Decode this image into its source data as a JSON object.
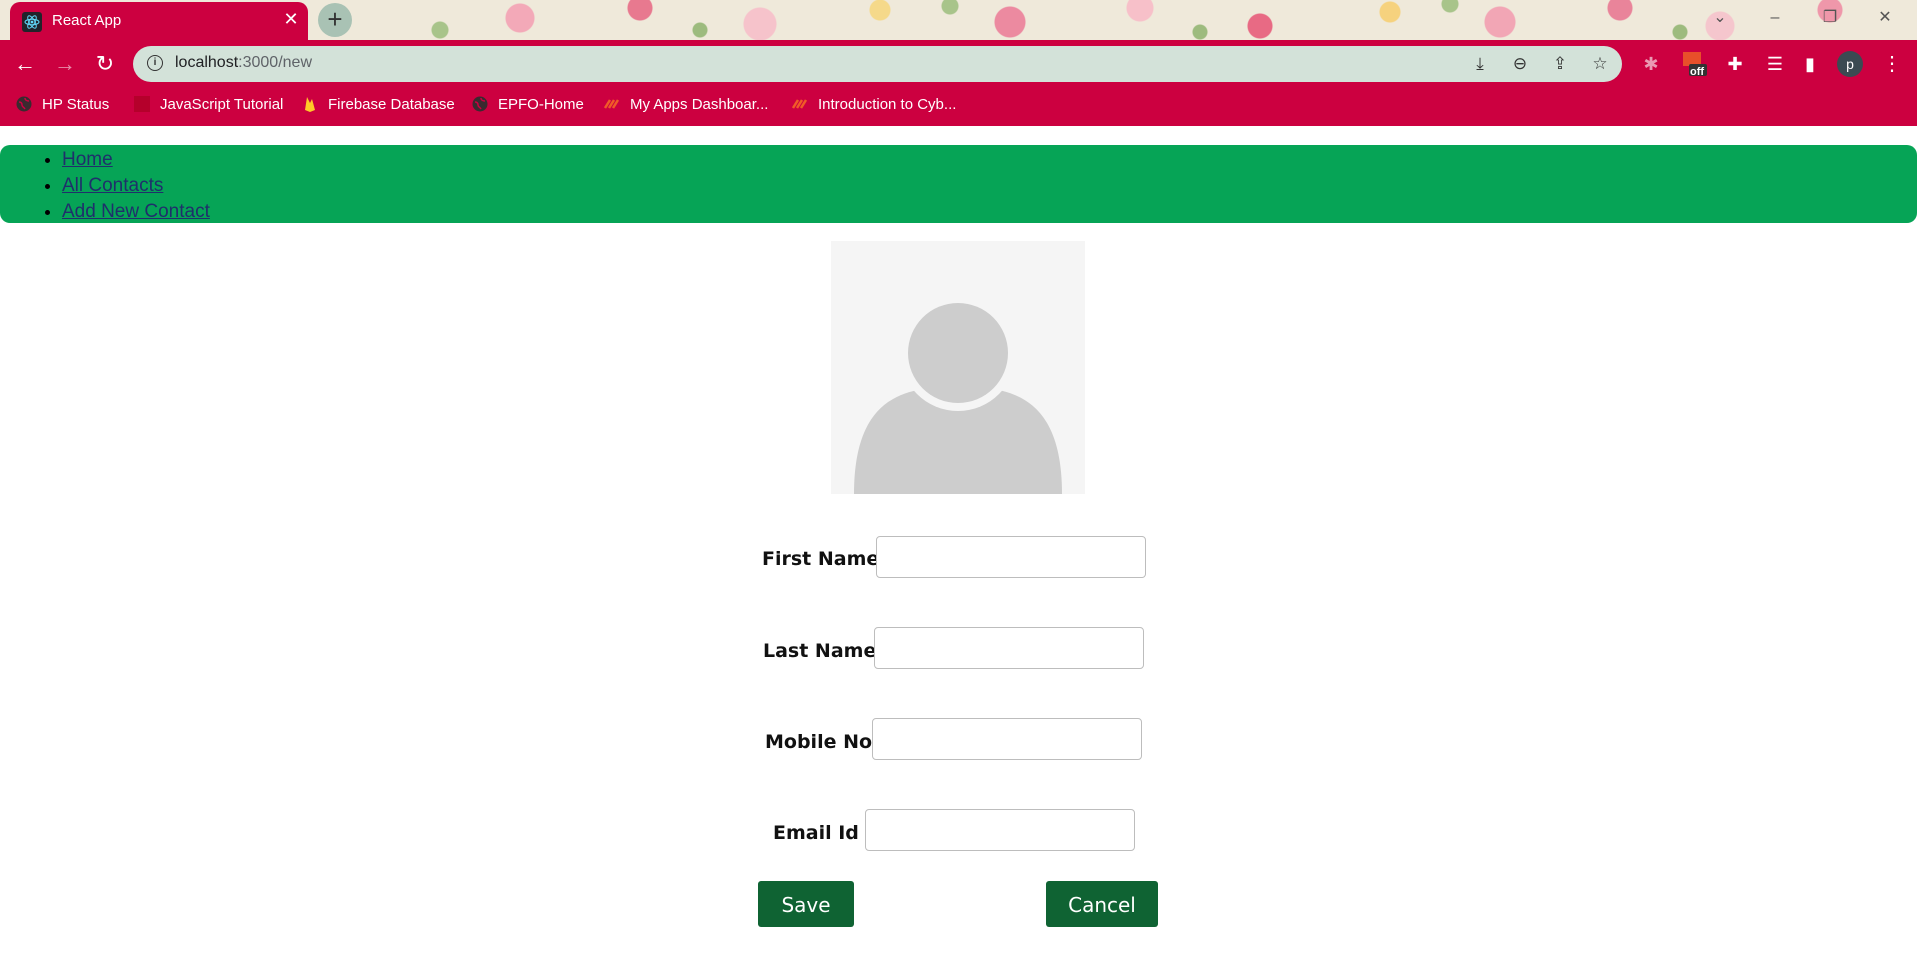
{
  "browser": {
    "tab_title": "React App",
    "url_host": "localhost",
    "url_path": ":3000/new",
    "accent_color": "#cc0040",
    "bookmarks": [
      {
        "label": "HP Status",
        "icon": "globe-icon"
      },
      {
        "label": "JavaScript Tutorial",
        "icon": "js-icon"
      },
      {
        "label": "Firebase Database",
        "icon": "firebase-icon"
      },
      {
        "label": "EPFO-Home",
        "icon": "globe-icon"
      },
      {
        "label": "My Apps Dashboar...",
        "icon": "apps-icon"
      },
      {
        "label": "Introduction to Cyb...",
        "icon": "apps-icon"
      }
    ],
    "profile_initial": "p",
    "pdf_badge": "off"
  },
  "nav": {
    "color": "#06a456",
    "links": [
      {
        "label": "Home"
      },
      {
        "label": "All Contacts"
      },
      {
        "label": "Add New Contact"
      }
    ]
  },
  "form": {
    "first_name_label": "First Name :",
    "last_name_label": "Last Name :",
    "mobile_label": "Mobile No :",
    "email_label": "Email Id :",
    "first_name_value": "",
    "last_name_value": "",
    "mobile_value": "",
    "email_value": "",
    "save_label": "Save",
    "cancel_label": "Cancel",
    "button_color": "#0f6333"
  }
}
